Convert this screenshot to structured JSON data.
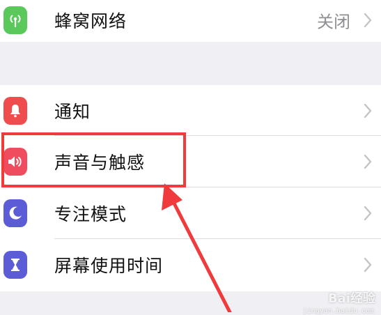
{
  "settings": {
    "cellular": {
      "label": "蜂窝网络",
      "value": "关闭",
      "icon": "antenna-icon",
      "color": "#5ac85a"
    },
    "items": [
      {
        "label": "通知",
        "icon": "bell-icon",
        "color": "#ef4d4d"
      },
      {
        "label": "声音与触感",
        "icon": "speaker-icon",
        "color": "#ef4d5f"
      },
      {
        "label": "专注模式",
        "icon": "moon-icon",
        "color": "#5b5cd6"
      },
      {
        "label": "屏幕使用时间",
        "icon": "hourglass-icon",
        "color": "#5b5cd6"
      }
    ]
  },
  "annotation": {
    "color": "#ef3b3b"
  },
  "watermark": {
    "text": "Bai经验",
    "sub": "jingyan.baidu.com"
  }
}
